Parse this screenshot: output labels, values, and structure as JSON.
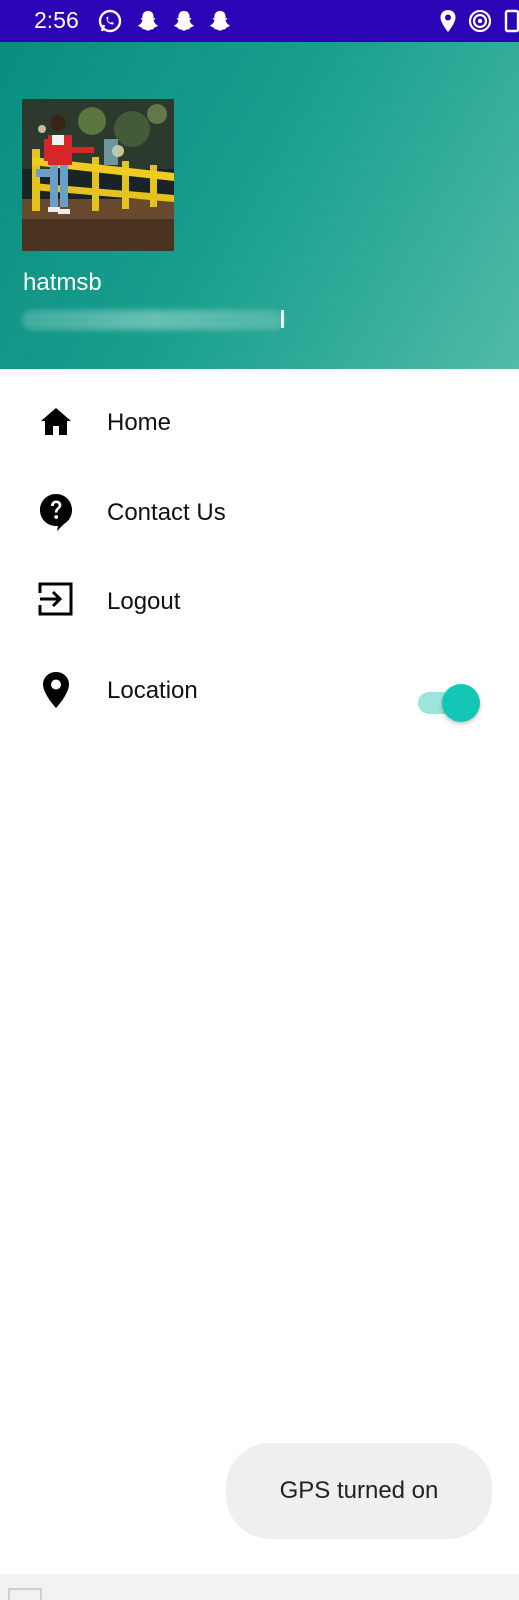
{
  "status_bar": {
    "time": "2:56",
    "background": "#2b05b5",
    "left_icons": [
      "whatsapp-icon",
      "snapchat-icon",
      "snapchat-icon",
      "snapchat-icon"
    ],
    "right_icons": [
      "location-pin-icon",
      "hotspot-icon",
      "battery-icon"
    ]
  },
  "header": {
    "username": "hatmsb",
    "email": "",
    "gradient": [
      "#0a8d80",
      "#52bba8"
    ]
  },
  "menu": {
    "items": [
      {
        "label": "Home",
        "icon": "home-icon"
      },
      {
        "label": "Contact Us",
        "icon": "help-bubble-icon"
      },
      {
        "label": "Logout",
        "icon": "logout-icon"
      },
      {
        "label": "Location",
        "icon": "location-pin-icon",
        "toggle": true
      }
    ]
  },
  "location_toggle": {
    "state": "on",
    "accent": "#12c7b6"
  },
  "toast": {
    "text": "GPS turned on"
  }
}
